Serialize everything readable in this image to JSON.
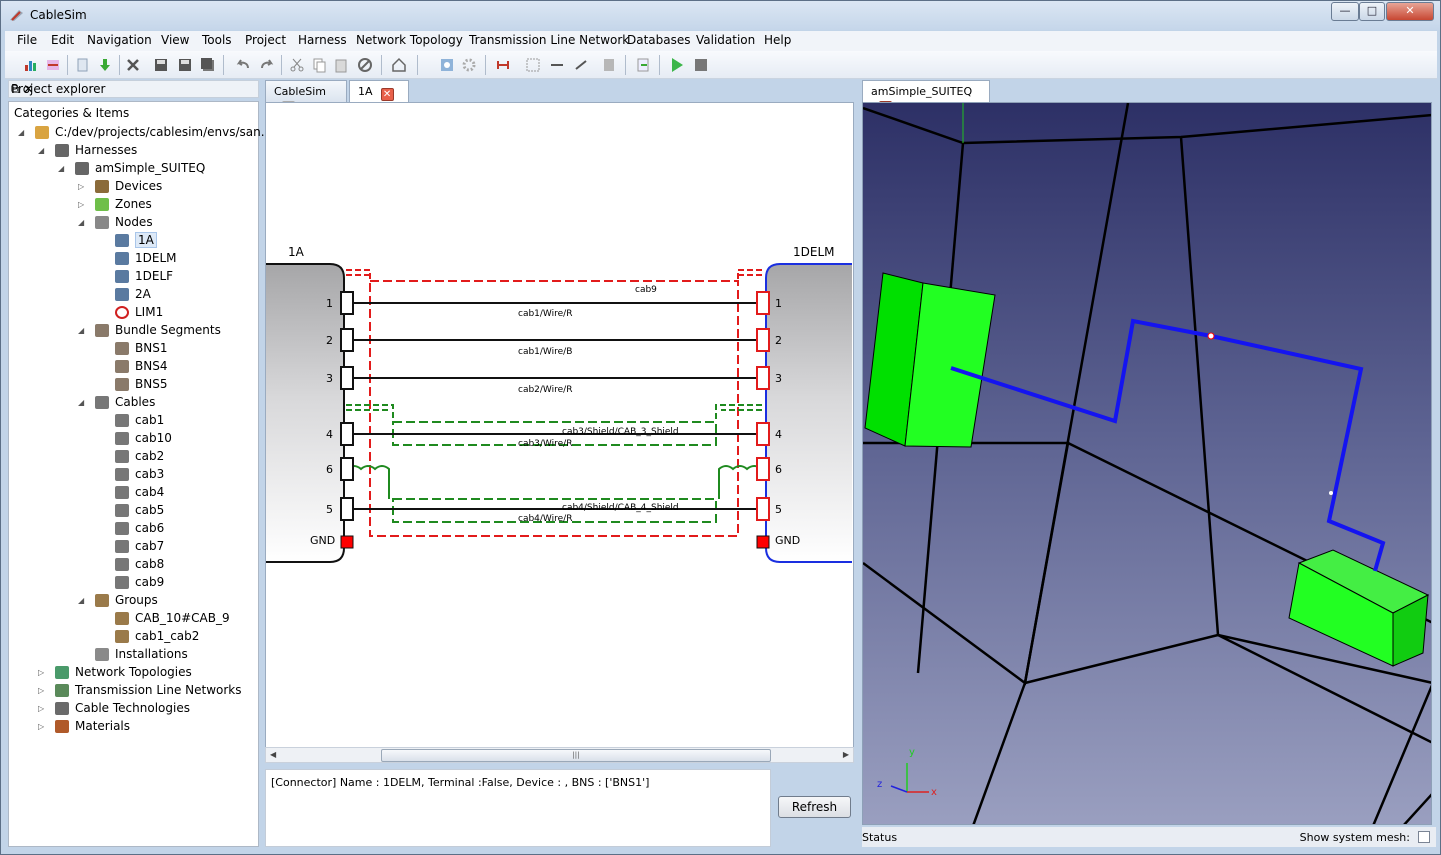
{
  "window": {
    "title": "CableSim",
    "minimize": "—",
    "maximize": "□",
    "close": "✕"
  },
  "menu": [
    "File",
    "Edit",
    "Navigation",
    "View",
    "Tools",
    "Project",
    "Harness",
    "Network Topology",
    "Transmission Line Network",
    "Databases",
    "Validation",
    "Help"
  ],
  "project_explorer": {
    "title": "Project explorer",
    "header": "Categories & Items",
    "tree": [
      {
        "label": "C:/dev/projects/cablesim/envs/san...",
        "icon": "folder-icon"
      },
      {
        "label": "Harnesses",
        "icon": "harness-icon"
      },
      {
        "label": "amSimple_SUITEQ",
        "icon": "harness-icon"
      },
      {
        "label": "Devices",
        "icon": "device-icon"
      },
      {
        "label": "Zones",
        "icon": "zone-icon"
      },
      {
        "label": "Nodes",
        "icon": "node-icon"
      },
      {
        "label": "1A",
        "icon": "connector-icon",
        "selected": true
      },
      {
        "label": "1DELM",
        "icon": "connector-icon"
      },
      {
        "label": "1DELF",
        "icon": "connector-icon"
      },
      {
        "label": "2A",
        "icon": "connector-icon"
      },
      {
        "label": "LIM1",
        "icon": "limit-icon"
      },
      {
        "label": "Bundle Segments",
        "icon": "bundle-icon"
      },
      {
        "label": "BNS1",
        "icon": "bundle-icon"
      },
      {
        "label": "BNS4",
        "icon": "bundle-icon"
      },
      {
        "label": "BNS5",
        "icon": "bundle-icon"
      },
      {
        "label": "Cables",
        "icon": "cable-icon"
      },
      {
        "label": "cab1",
        "icon": "cable-icon"
      },
      {
        "label": "cab10",
        "icon": "cable-icon"
      },
      {
        "label": "cab2",
        "icon": "cable-icon"
      },
      {
        "label": "cab3",
        "icon": "cable-icon"
      },
      {
        "label": "cab4",
        "icon": "cable-icon"
      },
      {
        "label": "cab5",
        "icon": "cable-icon"
      },
      {
        "label": "cab6",
        "icon": "cable-icon"
      },
      {
        "label": "cab7",
        "icon": "cable-icon"
      },
      {
        "label": "cab8",
        "icon": "cable-icon"
      },
      {
        "label": "cab9",
        "icon": "cable-icon"
      },
      {
        "label": "Groups",
        "icon": "group-icon"
      },
      {
        "label": "CAB_10#CAB_9",
        "icon": "group-icon"
      },
      {
        "label": "cab1_cab2",
        "icon": "group-icon"
      },
      {
        "label": "Installations",
        "icon": "installation-icon"
      },
      {
        "label": "Network Topologies",
        "icon": "network-icon"
      },
      {
        "label": "Transmission Line Networks",
        "icon": "tln-icon"
      },
      {
        "label": "Cable Technologies",
        "icon": "technology-icon"
      },
      {
        "label": "Materials",
        "icon": "material-icon"
      }
    ]
  },
  "middle": {
    "tabs": [
      {
        "label": "CableSim"
      },
      {
        "label": "1A"
      }
    ],
    "schematic": {
      "left_connector": "1A",
      "right_connector": "1DELM",
      "pins": [
        "1",
        "2",
        "3",
        "4",
        "6",
        "5"
      ],
      "gnd": "GND",
      "wire_labels": [
        "cab9",
        "cab1/Wire/R",
        "cab1/Wire/B",
        "cab2/Wire/R",
        "cab3/Shield/CAB_3_Shield",
        "cab3/Wire/R",
        "cab4/Shield/CAB_4_Shield",
        "cab4/Wire/R"
      ]
    },
    "info": "[Connector] Name : 1DELM, Terminal :False, Device : , BNS : ['BNS1']",
    "refresh": "Refresh"
  },
  "right": {
    "tabs": [
      {
        "label": "amSimple_SUITEQ"
      }
    ],
    "axes": {
      "x": "x",
      "y": "y",
      "z": "z"
    },
    "status": "Status",
    "show_mesh": "Show system mesh:"
  }
}
